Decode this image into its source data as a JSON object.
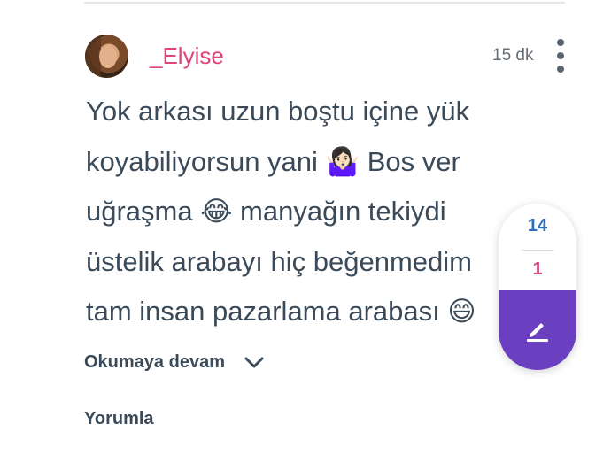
{
  "post": {
    "username": "_Elyise",
    "time": "15 dk",
    "text": "Yok arkası uzun boştu içine yük\nkoyabiliyorsun yani 🤷🏻‍♀️ Bos ver\nuğraşma 😂 manyağın tekiydi\nüstelik arabayı hiç beğenmedim\ntam insan pazarlama arabası 😄",
    "read_more_label": "Okumaya devam",
    "comment_label": "Yorumla"
  },
  "votes": {
    "up": "14",
    "down": "1"
  },
  "icons": {
    "more": "more-vertical-icon",
    "chevron": "chevron-down-icon",
    "edit": "pencil-icon"
  },
  "colors": {
    "username": "#e0457a",
    "upvote": "#2f6fb7",
    "downvote": "#d24d84",
    "edit_button": "#6a3fc0"
  }
}
